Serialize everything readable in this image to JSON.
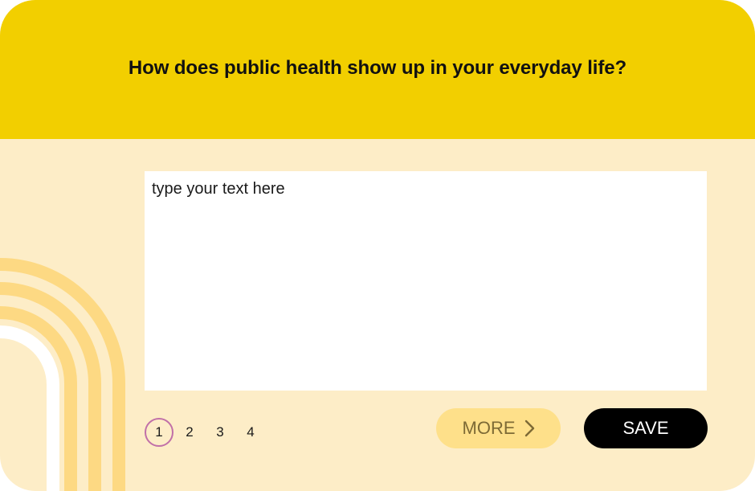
{
  "header": {
    "question": "How does public health show up in your everyday life?"
  },
  "answer": {
    "placeholder": "type your text here",
    "value": ""
  },
  "pagination": {
    "pages": [
      "1",
      "2",
      "3",
      "4"
    ],
    "current": "1"
  },
  "buttons": {
    "more_label": "MORE",
    "save_label": "SAVE"
  },
  "icons": {
    "more": "chevron-right-icon",
    "decoration": "rainbow-arches"
  },
  "colors": {
    "header_bg": "#f2cf00",
    "card_bg": "#fdedc7",
    "arch": "#fdd983",
    "more_bg": "#fee08a",
    "save_bg": "#000000",
    "active_page_ring": "#c170a8"
  }
}
